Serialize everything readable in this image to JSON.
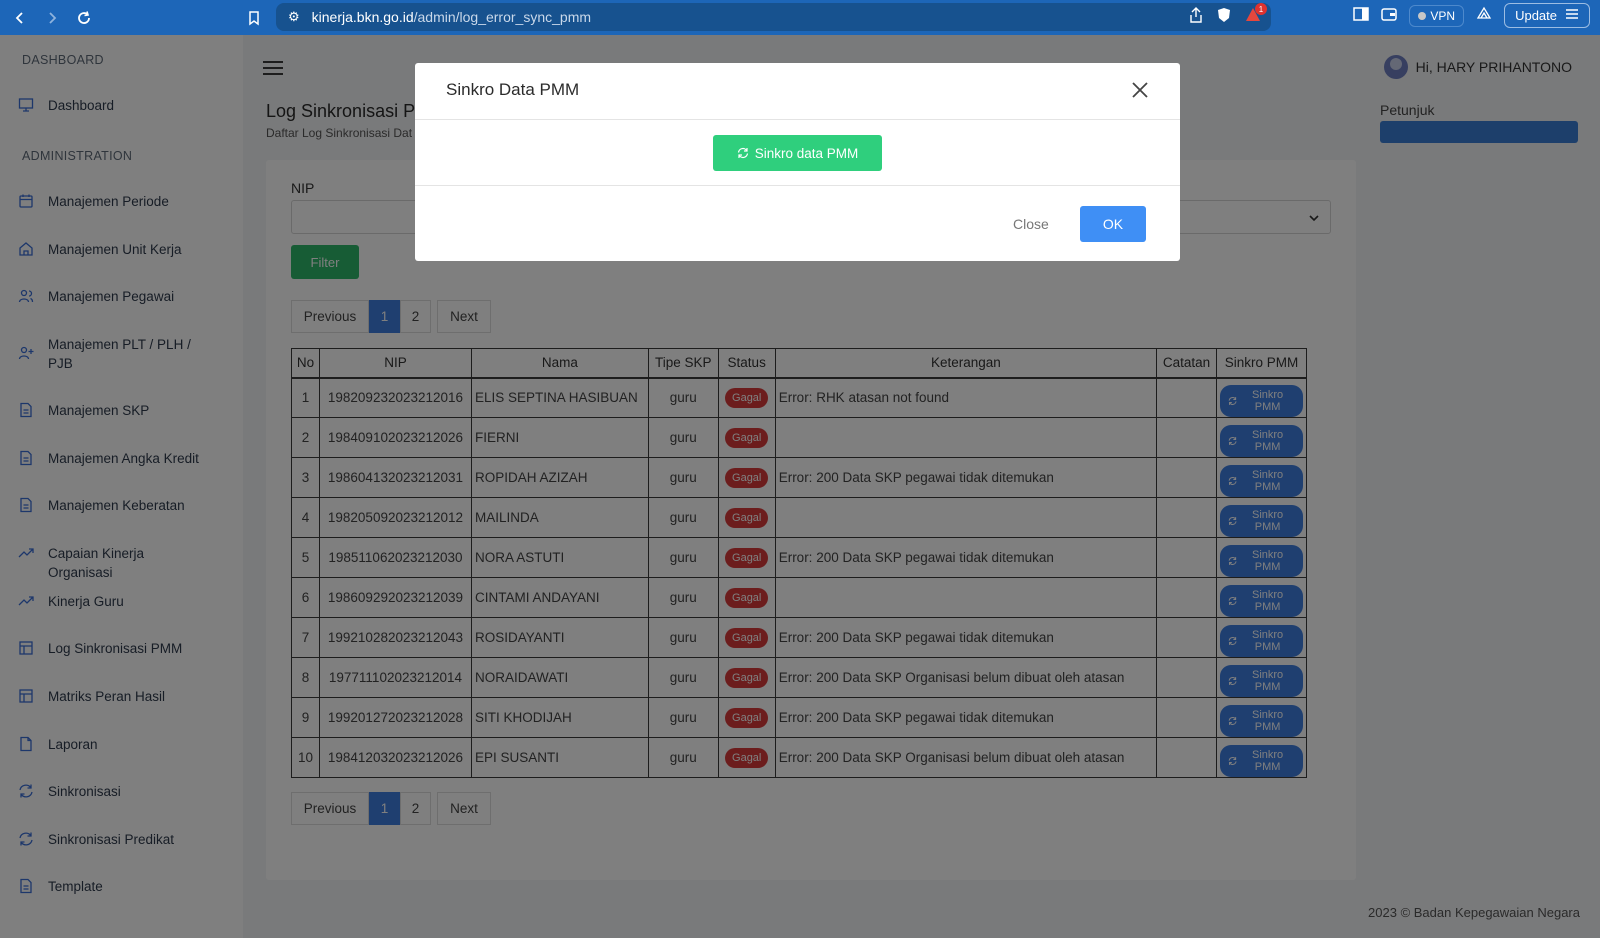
{
  "browser": {
    "url_host": "kinerja.bkn.go.id",
    "url_path": "/admin/log_error_sync_pmm",
    "notification_count": "1",
    "vpn_label": "VPN",
    "update_label": "Update"
  },
  "sidebar": {
    "sections": {
      "dashboard": "DASHBOARD",
      "admin": "ADMINISTRATION"
    },
    "dashboard_item": "Dashboard",
    "items": [
      {
        "label": "Manajemen Periode",
        "icon": "calendar-icon"
      },
      {
        "label": "Manajemen Unit Kerja",
        "icon": "home-icon"
      },
      {
        "label": "Manajemen Pegawai",
        "icon": "users-icon"
      },
      {
        "label": "Manajemen PLT / PLH / PJB",
        "icon": "user-plus-icon"
      },
      {
        "label": "Manajemen SKP",
        "icon": "file-icon"
      },
      {
        "label": "Manajemen Angka Kredit",
        "icon": "file-icon"
      },
      {
        "label": "Manajemen Keberatan",
        "icon": "file-icon"
      },
      {
        "label": "Capaian Kinerja Organisasi",
        "icon": "trending-icon"
      },
      {
        "label": "Kinerja Guru",
        "icon": "trending-icon"
      },
      {
        "label": "Log Sinkronisasi PMM",
        "icon": "layout-icon"
      },
      {
        "label": "Matriks Peran Hasil",
        "icon": "layout-icon"
      },
      {
        "label": "Laporan",
        "icon": "file-blank-icon"
      },
      {
        "label": "Sinkronisasi",
        "icon": "refresh-icon"
      },
      {
        "label": "Sinkronisasi Predikat",
        "icon": "refresh-icon"
      },
      {
        "label": "Template",
        "icon": "file-icon"
      }
    ]
  },
  "header": {
    "user_greeting": "Hi, HARY PRIHANTONO",
    "page_title": "Log Sinkronisasi PI",
    "page_subtitle": "Daftar Log Sinkronisasi Dat",
    "petunjuk": "Petunjuk"
  },
  "filter": {
    "nip_label": "NIP",
    "nip_value": "",
    "filter_button": "Filter"
  },
  "pagination": {
    "previous": "Previous",
    "next": "Next",
    "pages": [
      "1",
      "2"
    ]
  },
  "table": {
    "columns": [
      "No",
      "NIP",
      "Nama",
      "Tipe SKP",
      "Status",
      "Keterangan",
      "Catatan",
      "Sinkro PMM"
    ],
    "status_label": "Gagal",
    "sync_label": "Sinkro PMM",
    "rows": [
      {
        "no": "1",
        "nip": "198209232023212016",
        "nama": "ELIS SEPTINA HASIBUAN",
        "tipe": "guru",
        "ket": "Error: RHK atasan not found",
        "catatan": ""
      },
      {
        "no": "2",
        "nip": "198409102023212026",
        "nama": "FIERNI",
        "tipe": "guru",
        "ket": "",
        "catatan": ""
      },
      {
        "no": "3",
        "nip": "198604132023212031",
        "nama": "ROPIDAH AZIZAH",
        "tipe": "guru",
        "ket": "Error: 200 Data SKP pegawai tidak ditemukan",
        "catatan": ""
      },
      {
        "no": "4",
        "nip": "198205092023212012",
        "nama": "MAILINDA",
        "tipe": "guru",
        "ket": "",
        "catatan": ""
      },
      {
        "no": "5",
        "nip": "198511062023212030",
        "nama": "NORA ASTUTI",
        "tipe": "guru",
        "ket": "Error: 200 Data SKP pegawai tidak ditemukan",
        "catatan": ""
      },
      {
        "no": "6",
        "nip": "198609292023212039",
        "nama": "CINTAMI ANDAYANI",
        "tipe": "guru",
        "ket": "",
        "catatan": ""
      },
      {
        "no": "7",
        "nip": "199210282023212043",
        "nama": "ROSIDAYANTI",
        "tipe": "guru",
        "ket": "Error: 200 Data SKP pegawai tidak ditemukan",
        "catatan": ""
      },
      {
        "no": "8",
        "nip": "197711102023212014",
        "nama": "NORAIDAWATI",
        "tipe": "guru",
        "ket": "Error: 200 Data SKP Organisasi belum dibuat oleh atasan",
        "catatan": ""
      },
      {
        "no": "9",
        "nip": "199201272023212028",
        "nama": "SITI KHODIJAH",
        "tipe": "guru",
        "ket": "Error: 200 Data SKP pegawai tidak ditemukan",
        "catatan": ""
      },
      {
        "no": "10",
        "nip": "198412032023212026",
        "nama": "EPI SUSANTI",
        "tipe": "guru",
        "ket": "Error: 200 Data SKP Organisasi belum dibuat oleh atasan",
        "catatan": ""
      }
    ]
  },
  "footer": {
    "copyright": "2023 © Badan Kepegawaian Negara"
  },
  "modal": {
    "title": "Sinkro Data PMM",
    "sync_button": "Sinkro data PMM",
    "close_label": "Close",
    "ok_label": "OK"
  },
  "colors": {
    "chrome": "#1d66b8",
    "primary": "#3f7fe0",
    "success": "#2fcf7d",
    "danger": "#d83a3a"
  }
}
